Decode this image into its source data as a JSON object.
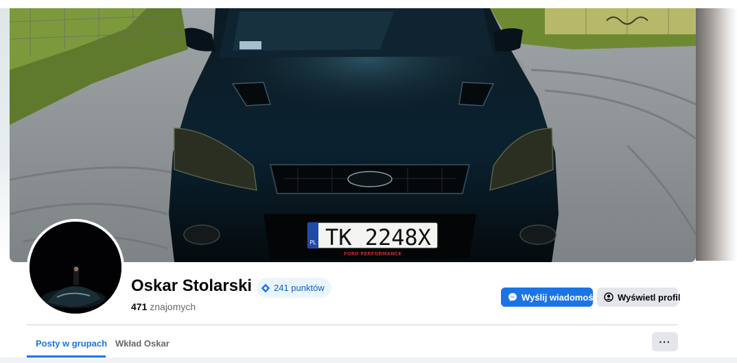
{
  "profile": {
    "name": "Oskar Stolarski",
    "points_label": "241 punktów",
    "friends_count": "471",
    "friends_label": "znajomych"
  },
  "cover": {
    "plate_country": "PL",
    "plate_text": "TK 2248X",
    "plate_frame_text": "FORD PERFORMANCE"
  },
  "actions": {
    "message_label": "Wyślij wiadomość",
    "view_profile_label": "Wyświetl profil",
    "more_label": "···"
  },
  "tabs": [
    {
      "label": "Posty w grupach",
      "active": true
    },
    {
      "label": "Wkład Oskar",
      "active": false
    }
  ],
  "colors": {
    "accent": "#1b74e4",
    "badge_bg": "#ebf5ff",
    "secondary_btn": "#e4e6eb",
    "muted_text": "#65676b"
  },
  "icons": {
    "badge": "diamond-badge-icon",
    "message": "messenger-icon",
    "profile": "user-circle-icon",
    "more": "more-dots-icon"
  }
}
